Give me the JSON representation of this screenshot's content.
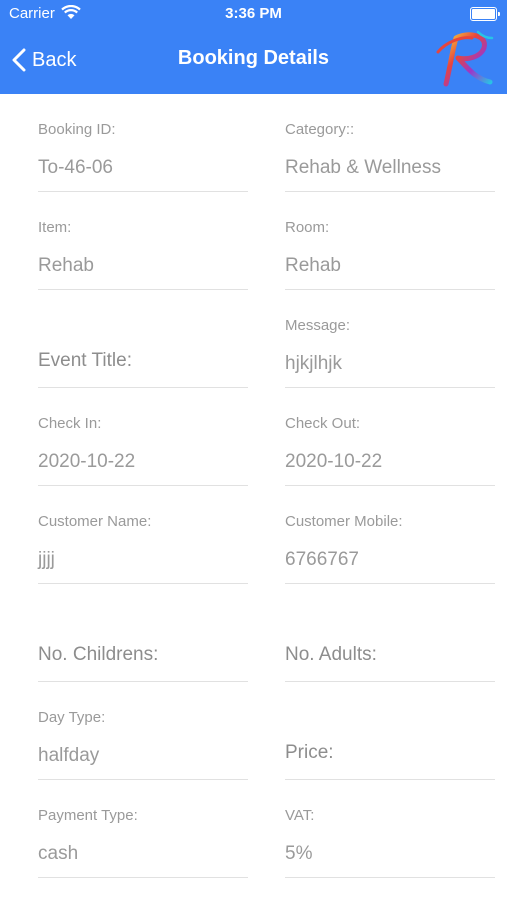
{
  "status_bar": {
    "carrier": "Carrier",
    "time": "3:36 PM"
  },
  "header": {
    "back_label": "Back",
    "title": "Booking Details"
  },
  "fields": {
    "booking_id": {
      "label": "Booking ID:",
      "value": "To-46-06"
    },
    "category": {
      "label": "Category::",
      "value": "Rehab & Wellness"
    },
    "item": {
      "label": "Item:",
      "value": "Rehab"
    },
    "room": {
      "label": "Room:",
      "value": "Rehab"
    },
    "event_title": {
      "label": "Event Title:"
    },
    "message": {
      "label": "Message:",
      "value": "hjkjlhjk"
    },
    "check_in": {
      "label": "Check In:",
      "value": "2020-10-22"
    },
    "check_out": {
      "label": "Check Out:",
      "value": "2020-10-22"
    },
    "customer_name": {
      "label": "Customer Name:",
      "value": "jjjj"
    },
    "customer_mobile": {
      "label": "Customer Mobile:",
      "value": "6766767"
    },
    "no_childrens": {
      "label": "No. Childrens:"
    },
    "no_adults": {
      "label": "No. Adults:"
    },
    "day_type": {
      "label": "Day Type:",
      "value": "halfday"
    },
    "price": {
      "label": "Price:"
    },
    "payment_type": {
      "label": "Payment Type:",
      "value": "cash"
    },
    "vat": {
      "label": "VAT:",
      "value": "5%"
    }
  }
}
